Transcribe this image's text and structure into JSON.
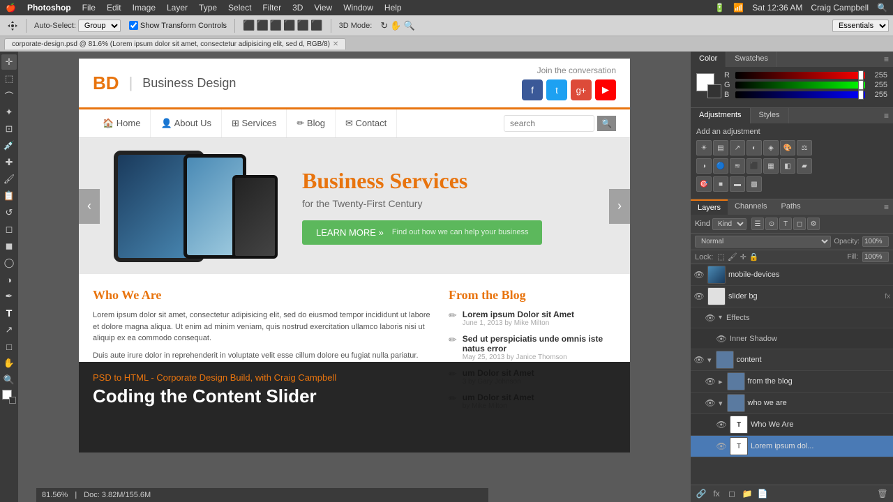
{
  "menubar": {
    "apple": "🍎",
    "app": "Photoshop",
    "menus": [
      "File",
      "Edit",
      "Image",
      "Layer",
      "Type",
      "Select",
      "Filter",
      "3D",
      "View",
      "Window",
      "Help"
    ],
    "time": "Sat 12:36 AM",
    "user": "Craig Campbell"
  },
  "toolbar": {
    "autoselect_label": "Auto-Select:",
    "group_value": "Group",
    "show_transform": "Show Transform Controls",
    "mode_label": "3D Mode:",
    "essentials": "Essentials"
  },
  "tab": {
    "filename": "corporate-design.psd @ 81.6% (Lorem ipsum dolor sit amet, consectetur adipisicing elit, sed d, RGB/8)"
  },
  "website": {
    "logo_bd": "BD",
    "logo_sep": "|",
    "logo_text": "Business Design",
    "join_text": "Join the conversation",
    "nav": [
      "Home",
      "About Us",
      "Services",
      "Blog",
      "Contact"
    ],
    "search_placeholder": "search",
    "slider_title": "Business Services",
    "slider_subtitle": "for the Twenty-First Century",
    "learn_more": "LEARN MORE »",
    "learn_sub": "Find out how we can help your business",
    "who_title": "Who We Are",
    "who_text1": "Lorem ipsum dolor sit amet, consectetur adipisicing elit, sed do eiusmod tempor incididunt ut labore et dolore magna aliqua. Ut enim ad minim veniam, quis nostrud exercitation ullamco laboris nisi ut aliquip ex ea commodo consequat.",
    "who_text2": "Duis aute irure dolor in reprehenderit in voluptate velit esse cillum dolore eu fugiat nulla pariatur.",
    "blog_title": "From the Blog",
    "blog_items": [
      {
        "title": "Lorem ipsum Dolor sit Amet",
        "date": "June 1, 2013",
        "author": "Mike Milton"
      },
      {
        "title": "Sed ut perspiciatis unde omnis iste natus error",
        "date": "May 25, 2013",
        "author": "Janice Thomson"
      },
      {
        "title": "um Dolor sit Amet",
        "date": "3 by Gary Johnson",
        "author": ""
      },
      {
        "title": "um Dolor sit Amet",
        "date": "by Mike Milton",
        "author": ""
      }
    ]
  },
  "overlay": {
    "subtitle_start": "PSD to HTML - Corporate Design Build, with ",
    "subtitle_name": "Craig Campbell",
    "title": "Coding the Content Slider"
  },
  "color_panel": {
    "tabs": [
      "Color",
      "Swatches"
    ],
    "r_val": "255",
    "g_val": "255",
    "b_val": "255"
  },
  "adj_panel": {
    "title": "Add an adjustment",
    "tabs": [
      "Adjustments",
      "Styles"
    ]
  },
  "layers_panel": {
    "tabs": [
      "Layers",
      "Channels",
      "Paths"
    ],
    "kind_label": "Kind",
    "blend_mode": "Normal",
    "opacity_label": "Opacity:",
    "opacity_val": "100%",
    "lock_label": "Lock:",
    "fill_label": "Fill:",
    "fill_val": "100%",
    "layers": [
      {
        "name": "mobile-devices",
        "visible": true,
        "type": "bitmap",
        "selected": false,
        "indent": 0
      },
      {
        "name": "slider bg",
        "visible": true,
        "type": "bitmap",
        "selected": false,
        "indent": 0,
        "fx": "fx"
      },
      {
        "name": "Effects",
        "visible": true,
        "type": "effect-group",
        "selected": false,
        "indent": 1
      },
      {
        "name": "Inner Shadow",
        "visible": true,
        "type": "effect",
        "selected": false,
        "indent": 2
      },
      {
        "name": "content",
        "visible": true,
        "type": "group",
        "selected": false,
        "indent": 0
      },
      {
        "name": "from the blog",
        "visible": true,
        "type": "group",
        "selected": false,
        "indent": 1
      },
      {
        "name": "who we are",
        "visible": true,
        "type": "group",
        "selected": false,
        "indent": 1
      },
      {
        "name": "Who We Are",
        "visible": true,
        "type": "text",
        "selected": false,
        "indent": 2
      },
      {
        "name": "Lorem ipsum dol...",
        "visible": true,
        "type": "text",
        "selected": true,
        "indent": 2
      }
    ]
  },
  "statusbar": {
    "zoom": "81.56%",
    "doc": "Doc: 3.82M/155.6M"
  }
}
